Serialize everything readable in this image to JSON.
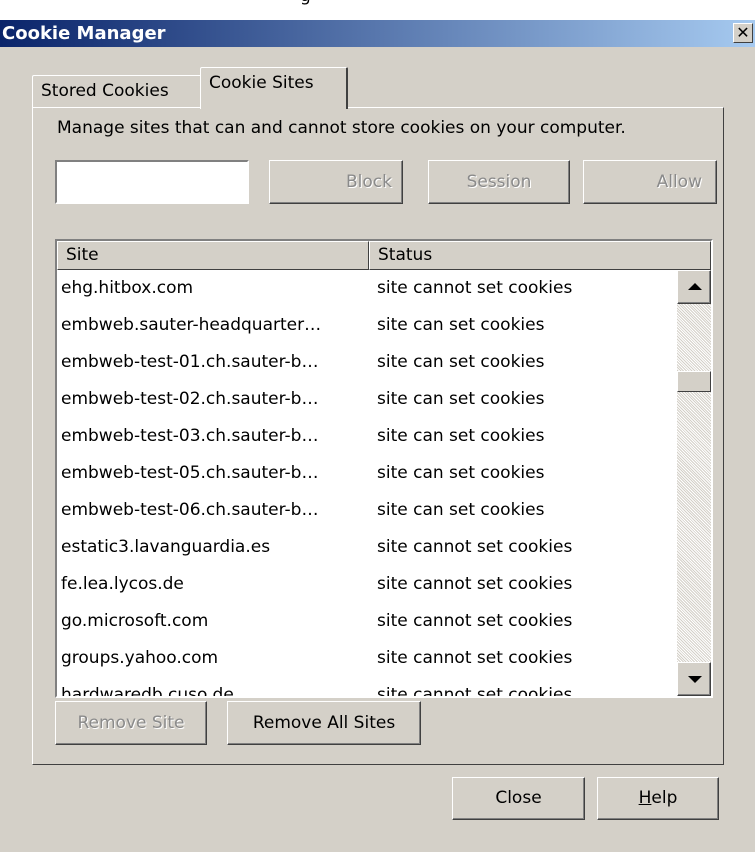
{
  "window": {
    "title": "Cookie Manager",
    "top_cut_text": "g"
  },
  "tabs": [
    {
      "label": "Stored Cookies",
      "active": false
    },
    {
      "label": "Cookie Sites",
      "active": true
    }
  ],
  "panel": {
    "description": "Manage sites that can and cannot store cookies on your computer.",
    "site_input_value": "",
    "block_label": "Block",
    "session_label": "Session",
    "allow_label": "Allow"
  },
  "table": {
    "columns": [
      "Site",
      "Status"
    ],
    "rows": [
      {
        "site": "ehg.hitbox.com",
        "status": "site cannot set cookies"
      },
      {
        "site": "embweb.sauter-headquarter…",
        "status": "site can set cookies"
      },
      {
        "site": "embweb-test-01.ch.sauter-b…",
        "status": "site can set cookies"
      },
      {
        "site": "embweb-test-02.ch.sauter-b…",
        "status": "site can set cookies"
      },
      {
        "site": "embweb-test-03.ch.sauter-b…",
        "status": "site can set cookies"
      },
      {
        "site": "embweb-test-05.ch.sauter-b…",
        "status": "site can set cookies"
      },
      {
        "site": "embweb-test-06.ch.sauter-b…",
        "status": "site can set cookies"
      },
      {
        "site": "estatic3.lavanguardia.es",
        "status": "site cannot set cookies"
      },
      {
        "site": "fe.lea.lycos.de",
        "status": "site cannot set cookies"
      },
      {
        "site": "go.microsoft.com",
        "status": "site cannot set cookies"
      },
      {
        "site": "groups.yahoo.com",
        "status": "site cannot set cookies"
      },
      {
        "site": "hardwaredb.cuso.de",
        "status": "site cannot set cookies"
      }
    ]
  },
  "buttons": {
    "remove_site": "Remove Site",
    "remove_all_sites": "Remove All Sites",
    "close": "Close",
    "help_accel": "H",
    "help_rest": "elp"
  },
  "icons": {
    "close": "close-icon",
    "scroll_up": "scroll-up-arrow-icon",
    "scroll_down": "scroll-down-arrow-icon"
  }
}
